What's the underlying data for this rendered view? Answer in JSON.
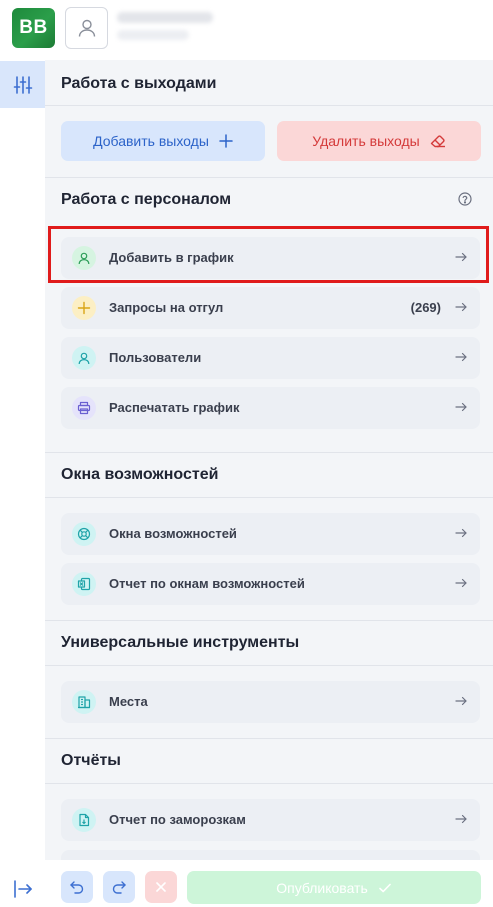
{
  "header": {
    "logo_text": "BB",
    "avatar_icon": "user-icon"
  },
  "sections": {
    "exits": {
      "title": "Работа с выходами",
      "add_label": "Добавить выходы",
      "delete_label": "Удалить выходы"
    },
    "staff": {
      "title": "Работа с персоналом",
      "items": [
        {
          "label": "Добавить в график",
          "icon": "user-icon",
          "icon_bg": "#d6f4e1",
          "icon_color": "#2f9e5a"
        },
        {
          "label": "Запросы на отгул",
          "icon": "plus-icon",
          "icon_bg": "#fcefc4",
          "icon_color": "#d9a516",
          "count": "(269)"
        },
        {
          "label": "Пользователи",
          "icon": "user-icon",
          "icon_bg": "#cff3f3",
          "icon_color": "#1fa3a8"
        },
        {
          "label": "Распечатать график",
          "icon": "printer-icon",
          "icon_bg": "#e5e3fb",
          "icon_color": "#6a5fd1"
        }
      ]
    },
    "windows": {
      "title": "Окна возможностей",
      "items": [
        {
          "label": "Окна возможностей",
          "icon": "lifebuoy-icon",
          "icon_bg": "#cff3f3",
          "icon_color": "#1fa3a8"
        },
        {
          "label": "Отчет по окнам возможностей",
          "icon": "excel-icon",
          "icon_bg": "#cff3f3",
          "icon_color": "#1fa3a8"
        }
      ]
    },
    "tools": {
      "title": "Универсальные инструменты",
      "items": [
        {
          "label": "Места",
          "icon": "building-icon",
          "icon_bg": "#cff3f3",
          "icon_color": "#1fa3a8"
        }
      ]
    },
    "reports": {
      "title": "Отчёты",
      "items": [
        {
          "label": "Отчет по заморозкам",
          "icon": "file-icon",
          "icon_bg": "#cff3f3",
          "icon_color": "#1fa3a8"
        }
      ]
    }
  },
  "toolbar": {
    "publish_label": "Опубликовать"
  }
}
